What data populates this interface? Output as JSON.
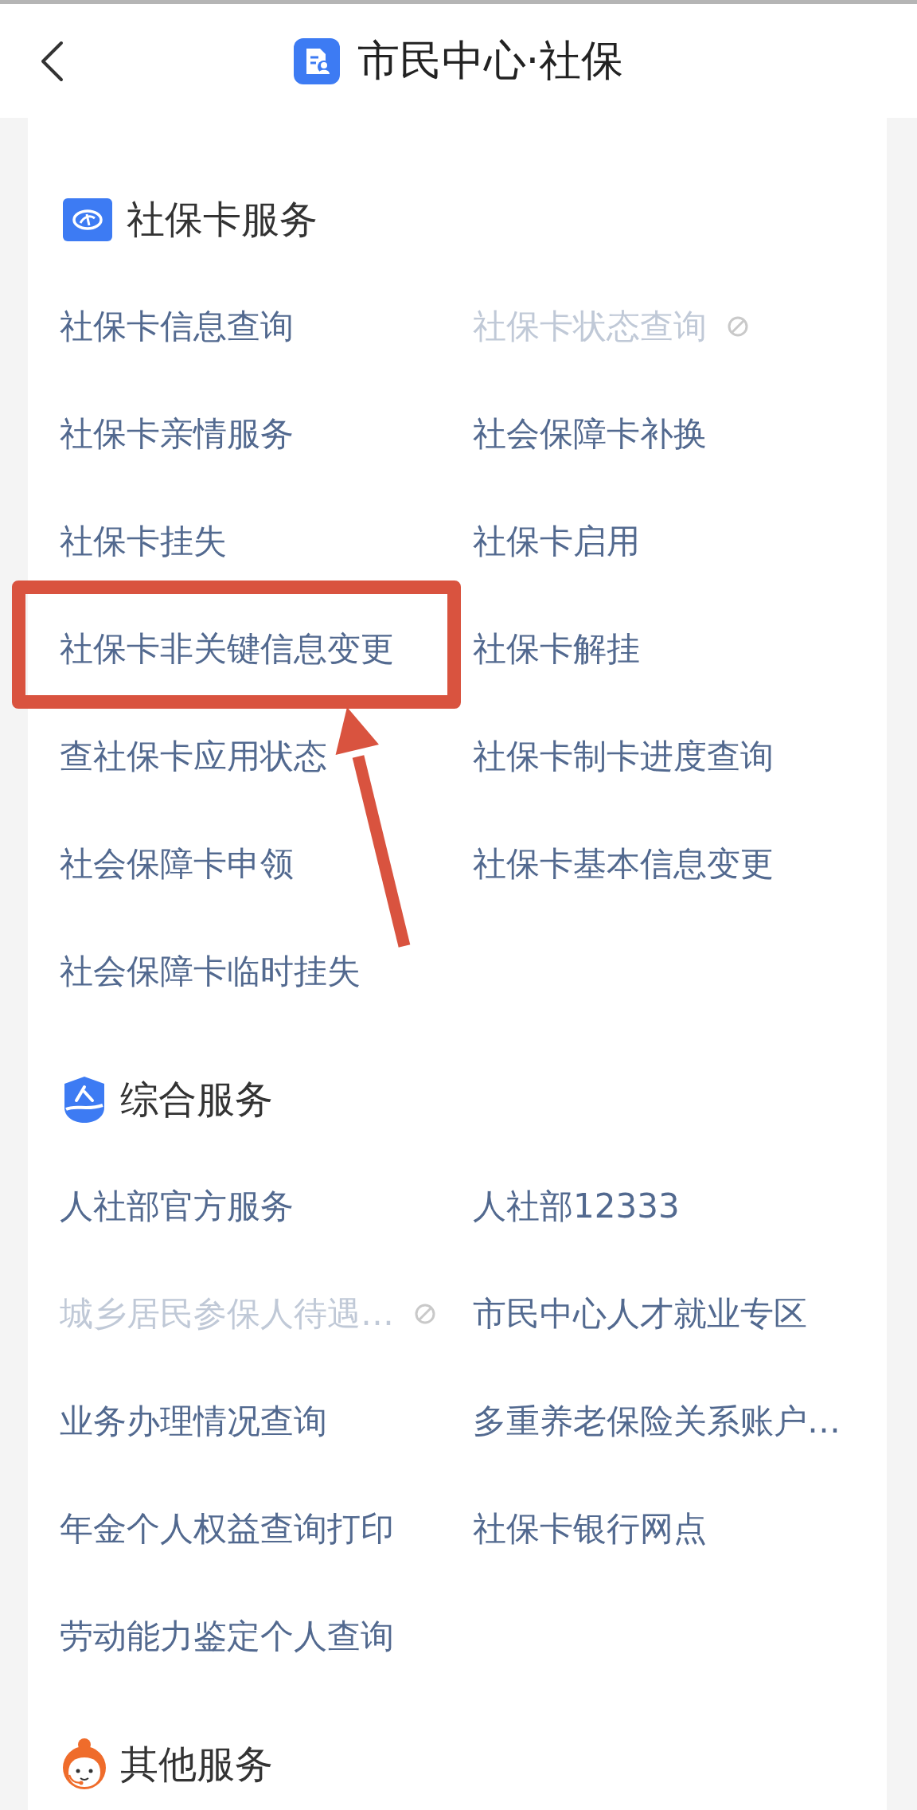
{
  "header": {
    "title": "市民中心·社保"
  },
  "sections": [
    {
      "title": "社保卡服务",
      "items": [
        {
          "label": "社保卡信息查询",
          "disabled": false,
          "highlighted": false
        },
        {
          "label": "社保卡状态查询",
          "disabled": true,
          "highlighted": false
        },
        {
          "label": "社保卡亲情服务",
          "disabled": false,
          "highlighted": false
        },
        {
          "label": "社会保障卡补换",
          "disabled": false,
          "highlighted": false
        },
        {
          "label": "社保卡挂失",
          "disabled": false,
          "highlighted": false
        },
        {
          "label": "社保卡启用",
          "disabled": false,
          "highlighted": false
        },
        {
          "label": "社保卡非关键信息变更",
          "disabled": false,
          "highlighted": true
        },
        {
          "label": "社保卡解挂",
          "disabled": false,
          "highlighted": false
        },
        {
          "label": "查社保卡应用状态",
          "disabled": false,
          "highlighted": false
        },
        {
          "label": "社保卡制卡进度查询",
          "disabled": false,
          "highlighted": false
        },
        {
          "label": "社会保障卡申领",
          "disabled": false,
          "highlighted": false
        },
        {
          "label": "社保卡基本信息变更",
          "disabled": false,
          "highlighted": false
        },
        {
          "label": "社会保障卡临时挂失",
          "disabled": false,
          "highlighted": false
        }
      ]
    },
    {
      "title": "综合服务",
      "items": [
        {
          "label": "人社部官方服务",
          "disabled": false,
          "highlighted": false
        },
        {
          "label": "人社部12333",
          "disabled": false,
          "highlighted": false
        },
        {
          "label": "城乡居民参保人待遇…",
          "disabled": true,
          "highlighted": false
        },
        {
          "label": "市民中心人才就业专区",
          "disabled": false,
          "highlighted": false
        },
        {
          "label": "业务办理情况查询",
          "disabled": false,
          "highlighted": false
        },
        {
          "label": "多重养老保险关系账户…",
          "disabled": false,
          "highlighted": false
        },
        {
          "label": "年金个人权益查询打印",
          "disabled": false,
          "highlighted": false
        },
        {
          "label": "社保卡银行网点",
          "disabled": false,
          "highlighted": false
        },
        {
          "label": "劳动能力鉴定个人查询",
          "disabled": false,
          "highlighted": false
        }
      ]
    },
    {
      "title": "其他服务"
    }
  ]
}
